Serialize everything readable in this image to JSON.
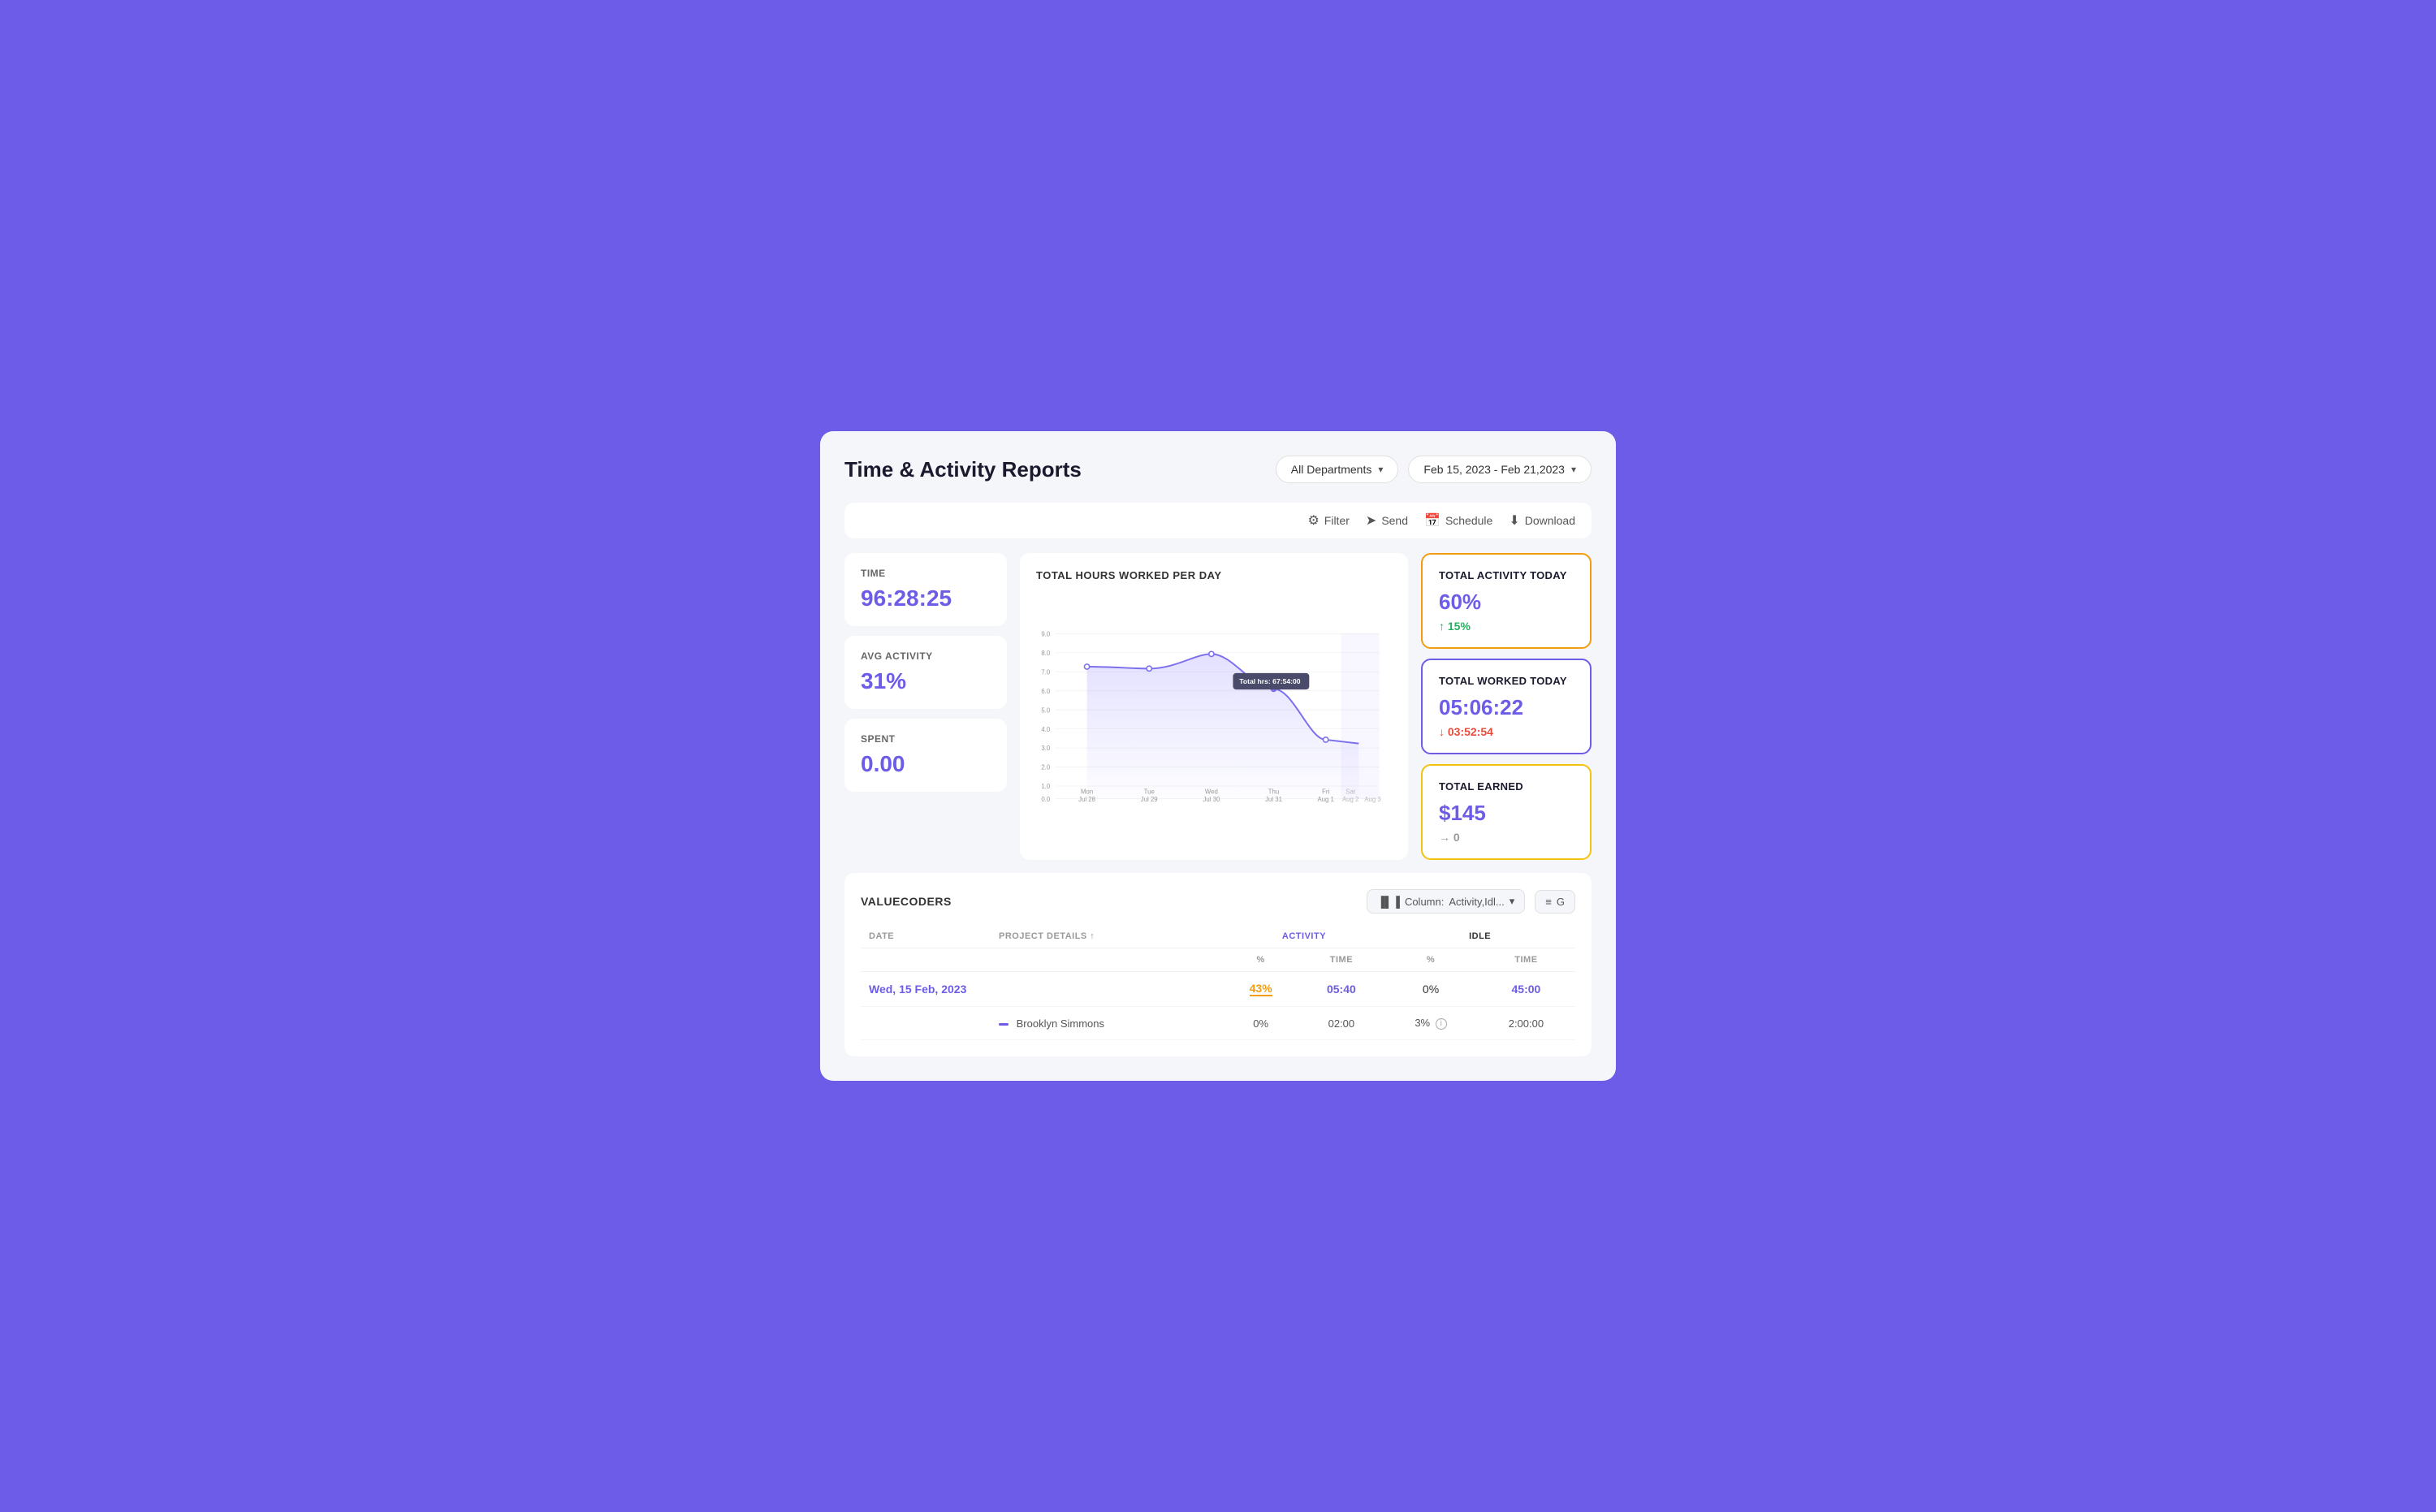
{
  "page": {
    "title": "Time & Activity Reports"
  },
  "header": {
    "department_selector": "All Departments",
    "date_range": "Feb 15, 2023 - Feb 21,2023"
  },
  "toolbar": {
    "filter_label": "Filter",
    "send_label": "Send",
    "schedule_label": "Schedule",
    "download_label": "Download"
  },
  "metrics": [
    {
      "label": "TIME",
      "value": "96:28:25"
    },
    {
      "label": "AVG ACTIVITY",
      "value": "31%"
    },
    {
      "label": "SPENT",
      "value": "0.00"
    }
  ],
  "chart": {
    "title": "TOTAL HOURS WORKED PER DAY",
    "y_labels": [
      "9.0",
      "8.0",
      "7.0",
      "6.0",
      "5.0",
      "4.0",
      "3.0",
      "2.0",
      "1.0",
      "0.0"
    ],
    "x_labels": [
      {
        "day": "Mon",
        "date": "Jul 28"
      },
      {
        "day": "Tue",
        "date": "Jul 29"
      },
      {
        "day": "Wed",
        "date": "Jul 30"
      },
      {
        "day": "Thu",
        "date": "Jul 31"
      },
      {
        "day": "Fri",
        "date": "Aug 1"
      },
      {
        "day": "Sat",
        "date": "Aug 2"
      },
      {
        "day": "",
        "date": "Aug 3"
      }
    ],
    "tooltip": "Total hrs: 67:54:00"
  },
  "side_cards": [
    {
      "id": "activity-today",
      "title": "TOTAL ACTIVITY TODAY",
      "value": "60%",
      "sub": "15%",
      "sub_type": "up",
      "border": "orange"
    },
    {
      "id": "worked-today",
      "title": "TOTAL WORKED TODAY",
      "value": "05:06:22",
      "sub": "03:52:54",
      "sub_type": "down",
      "border": "purple"
    },
    {
      "id": "earned-today",
      "title": "TOTAL EARNED",
      "value": "$145",
      "sub": "0",
      "sub_type": "right",
      "border": "yellow"
    }
  ],
  "table": {
    "org_name": "VALUECODERS",
    "column_selector_label": "Column:",
    "column_value": "Activity,Idl...",
    "group_label": "G",
    "columns": [
      {
        "label": "DATE",
        "key": "date"
      },
      {
        "label": "PROJECT DETAILS ↑",
        "key": "project"
      },
      {
        "label": "%",
        "key": "activity_pct",
        "group": "ACTIVITY"
      },
      {
        "label": "TIME",
        "key": "activity_time",
        "group": "ACTIVITY"
      },
      {
        "label": "%",
        "key": "idle_pct",
        "group": "IDLE"
      },
      {
        "label": "TIME",
        "key": "idle_time",
        "group": "IDLE"
      }
    ],
    "rows": [
      {
        "type": "group",
        "date": "Wed, 15 Feb, 2023",
        "project": "",
        "activity_pct": "43%",
        "activity_time": "05:40",
        "idle_pct": "0%",
        "idle_time": "45:00"
      },
      {
        "type": "employee",
        "date": "",
        "project": "Brooklyn Simmons",
        "activity_pct": "0%",
        "activity_time": "02:00",
        "idle_pct": "3%",
        "idle_time": "2:00:00"
      }
    ]
  }
}
